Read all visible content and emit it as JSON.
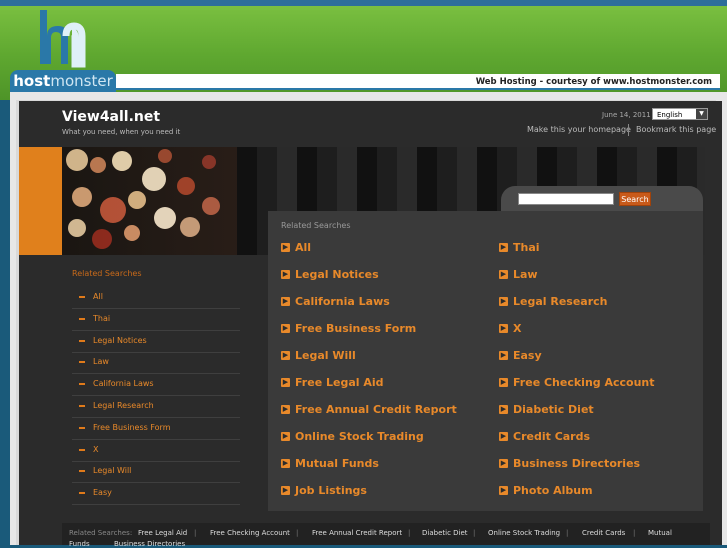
{
  "host": {
    "logo_part1": "host",
    "logo_part2": "monster",
    "courtesy": "Web Hosting - courtesy of www.hostmonster.com"
  },
  "site": {
    "title": "View4all.net",
    "tagline": "What you need, when you need it",
    "date": "June 14, 2011",
    "language": "English",
    "homepage_link": "Make this your homepage",
    "bookmark_link": "Bookmark this page"
  },
  "search": {
    "button": "Search",
    "value": ""
  },
  "main": {
    "heading": "Related Searches",
    "left": [
      "All",
      "Legal Notices",
      "California Laws",
      "Free Business Form",
      "Legal Will",
      "Free Legal Aid",
      "Free Annual Credit Report",
      "Online Stock Trading",
      "Mutual Funds",
      "Job Listings"
    ],
    "right": [
      "Thai",
      "Law",
      "Legal Research",
      "X",
      "Easy",
      "Free Checking Account",
      "Diabetic Diet",
      "Credit Cards",
      "Business Directories",
      "Photo Album"
    ]
  },
  "sidebar": {
    "heading": "Related Searches",
    "items": [
      "All",
      "Thai",
      "Legal Notices",
      "Law",
      "California Laws",
      "Legal Research",
      "Free Business Form",
      "X",
      "Legal Will",
      "Easy"
    ]
  },
  "footer": {
    "heading": "Related Searches:",
    "links": [
      "Free Legal Aid",
      "Free Checking Account",
      "Free Annual Credit Report",
      "Diabetic Diet",
      "Online Stock Trading",
      "Credit Cards",
      "Mutual",
      "Funds",
      "Business Directories"
    ]
  },
  "colors": {
    "accent": "#e8892a",
    "host_blue": "#2a78a8",
    "host_green": "#7dc242"
  }
}
